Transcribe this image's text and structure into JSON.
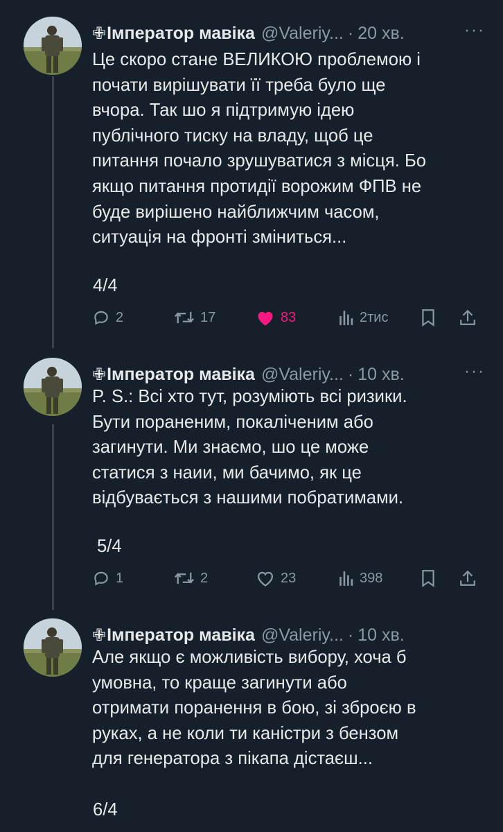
{
  "tweets": [
    {
      "display_name": "Імператор мавіка",
      "badge": "✙",
      "handle": "@Valeriy...",
      "time": "20 хв.",
      "lines": [
        "Це скоро стане ВЕЛИКОЮ проблемою і",
        "почати вирішувати її треба було ще",
        "вчора. Так шо я підтримую ідею",
        "публічного тиску на владу, щоб це",
        "питання почало зрушуватися з місця. Бо",
        "якщо питання протидії ворожим ФПВ не",
        "буде вирішено найближчим часом,",
        "ситуація на фронті зміниться..."
      ],
      "counter": "4/4",
      "replies": "2",
      "reposts": "17",
      "likes": "83",
      "liked": true,
      "views": "2тис"
    },
    {
      "display_name": "Імператор мавіка",
      "badge": "✙",
      "handle": "@Valeriy...",
      "time": "10 хв.",
      "lines": [
        "P. S.: Всі хто тут, розуміють всі ризики.",
        "Бути пораненим, покаліченим або",
        "загинути. Ми знаємо, шо це може",
        "статися з наии, ми бачимо, як це",
        "відбувається з нашими побратимами."
      ],
      "counter": "5/4",
      "replies": "1",
      "reposts": "2",
      "likes": "23",
      "liked": false,
      "views": "398"
    },
    {
      "display_name": "Імператор мавіка",
      "badge": "✙",
      "handle": "@Valeriy...",
      "time": "10 хв.",
      "lines": [
        "Але якщо є можливість вибору, хоча б",
        "умовна, то краще загинути або",
        "отримати поранення в бою, зі зброєю в",
        "руках, а не коли ти каністри з бензом",
        "для генератора з пікапа дістаєш..."
      ],
      "counter": "6/4"
    }
  ],
  "separator_dot": "·",
  "more_glyph": "···",
  "colors": {
    "background": "#15202b",
    "text": "#e7e9ea",
    "muted": "#8b98a5",
    "like": "#f91880",
    "thread_line": "#38444d"
  }
}
